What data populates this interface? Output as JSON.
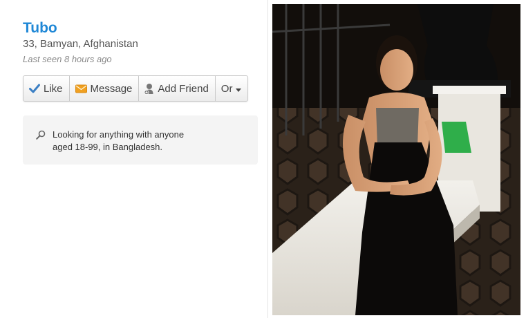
{
  "profile": {
    "name": "Tubo",
    "details": "33, Bamyan, Afghanistan",
    "last_seen": "Last seen 8 hours ago"
  },
  "actions": {
    "like": "Like",
    "message": "Message",
    "add_friend": "Add Friend",
    "or": "Or"
  },
  "looking_for": {
    "line1": "Looking for anything with anyone",
    "line2": "aged 18-99, in Bangladesh."
  },
  "icons": {
    "like": "checkmark-icon",
    "message": "envelope-icon",
    "add_friend": "person-plus-icon",
    "or": "caret-down-icon",
    "looking_for": "search-icon"
  },
  "colors": {
    "name": "#1e87d6",
    "like_check": "#3b7fc4",
    "message_icon": "#f0a020"
  }
}
